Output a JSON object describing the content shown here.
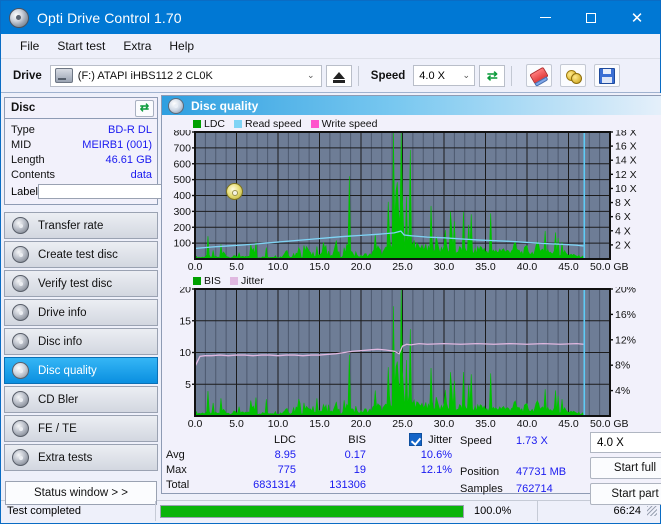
{
  "window": {
    "title": "Opti Drive Control 1.70",
    "icon": "disc-icon",
    "minimize": "–",
    "maximize": "□",
    "close": "✕"
  },
  "menu": {
    "items": [
      "File",
      "Start test",
      "Extra",
      "Help"
    ]
  },
  "toolbar": {
    "drive_label": "Drive",
    "drive_value": "(F:)  ATAPI iHBS112  2 CL0K",
    "eject_title": "Eject",
    "speed_label": "Speed",
    "speed_value": "4.0 X",
    "icons": [
      "refresh-icon",
      "erase-icon",
      "burn-icon",
      "save-icon"
    ]
  },
  "sidebar": {
    "disc": {
      "title": "Disc",
      "refresh_icon": "refresh-icon",
      "rows": [
        {
          "key": "Type",
          "value": "BD-R DL"
        },
        {
          "key": "MID",
          "value": "MEIRB1 (001)"
        },
        {
          "key": "Length",
          "value": "46.61 GB"
        },
        {
          "key": "Contents",
          "value": "data"
        }
      ],
      "label_key": "Label",
      "label_value": "",
      "label_placeholder": ""
    },
    "nav": [
      {
        "label": "Transfer rate",
        "active": false
      },
      {
        "label": "Create test disc",
        "active": false
      },
      {
        "label": "Verify test disc",
        "active": false
      },
      {
        "label": "Drive info",
        "active": false
      },
      {
        "label": "Disc info",
        "active": false
      },
      {
        "label": "Disc quality",
        "active": true
      },
      {
        "label": "CD Bler",
        "active": false
      },
      {
        "label": "FE / TE",
        "active": false
      },
      {
        "label": "Extra tests",
        "active": false
      }
    ],
    "status_window_button": "Status window > >"
  },
  "panel": {
    "title": "Disc quality",
    "icon": "disc-quality-icon"
  },
  "stats": {
    "headers": [
      "",
      "LDC",
      "BIS",
      "Jitter"
    ],
    "jitter_checked": true,
    "rows": [
      {
        "label": "Avg",
        "ldc": "8.95",
        "bis": "0.17",
        "jitter": "10.6%"
      },
      {
        "label": "Max",
        "ldc": "775",
        "bis": "19",
        "jitter": "12.1%"
      },
      {
        "label": "Total",
        "ldc": "6831314",
        "bis": "131306",
        "jitter": ""
      }
    ]
  },
  "readout": {
    "speed_key": "Speed",
    "speed_value": "1.73 X",
    "position_key": "Position",
    "position_value": "47731 MB",
    "samples_key": "Samples",
    "samples_value": "762714",
    "speed_select": "4.0 X",
    "start_full": "Start full",
    "start_part": "Start part"
  },
  "statusbar": {
    "message": "Test completed",
    "percent_text": "100.0%",
    "percent_value": 100,
    "elapsed": "66:24"
  },
  "colors": {
    "ldc": "#00c000",
    "bis": "#00c000",
    "read_speed": "#7fd4f5",
    "write_speed": "#ff55cc",
    "jitter": "#e0b8e0",
    "plot_bg": "#6e7d96",
    "accent": "#0078d4",
    "value_blue": "#1a1af0"
  },
  "chart_data": [
    {
      "type": "area",
      "name": "ldc-chart",
      "title": "",
      "xlabel": "GB",
      "ylabel": "LDC",
      "xlim": [
        0,
        50
      ],
      "ylim": [
        0,
        800
      ],
      "y2lim": [
        0,
        18
      ],
      "y2label": "X",
      "grid": true,
      "legend": [
        "LDC",
        "Read speed",
        "Write speed"
      ],
      "legend_position": "top-left",
      "xticks": [
        "0.0",
        "5.0",
        "10.0",
        "15.0",
        "20.0",
        "25.0",
        "30.0",
        "35.0",
        "40.0",
        "45.0",
        "50.0 GB"
      ],
      "yticks": [
        100,
        200,
        300,
        400,
        500,
        600,
        700,
        800
      ],
      "y2ticks": [
        "2 X",
        "4 X",
        "6 X",
        "8 X",
        "10 X",
        "12 X",
        "14 X",
        "16 X",
        "18 X"
      ],
      "series": [
        {
          "name": "LDC",
          "color": "#00c000",
          "kind": "area",
          "x": [
            0.0,
            0.5,
            1.0,
            1.5,
            2.0,
            2.5,
            3.0,
            3.5,
            4.0,
            4.5,
            5.0,
            5.5,
            6.0,
            6.5,
            7.0,
            7.5,
            8.0,
            8.5,
            9.0,
            9.5,
            10.0,
            10.5,
            11.0,
            11.5,
            12.0,
            12.5,
            13.0,
            13.5,
            14.0,
            14.5,
            15.0,
            15.5,
            16.0,
            16.5,
            17.0,
            17.5,
            18.0,
            18.5,
            19.0,
            19.5,
            20.0,
            20.5,
            21.0,
            21.5,
            22.0,
            22.5,
            23.0,
            23.5,
            24.0,
            24.3,
            24.6,
            24.9,
            25.2,
            25.5,
            25.8,
            26.1,
            26.5,
            27.0,
            27.5,
            28.0,
            28.5,
            29.0,
            29.5,
            30.0,
            30.5,
            31.0,
            31.5,
            32.0,
            32.5,
            33.0,
            33.5,
            34.0,
            34.5,
            35.0,
            35.5,
            36.0,
            36.5,
            37.0,
            37.5,
            38.0,
            38.5,
            39.0,
            39.5,
            40.0,
            40.5,
            41.0,
            41.5,
            42.0,
            42.5,
            43.0,
            43.5,
            44.0,
            44.5,
            45.0,
            45.5,
            46.0,
            46.5,
            46.8
          ],
          "y": [
            30,
            22,
            25,
            60,
            20,
            28,
            22,
            95,
            25,
            30,
            40,
            22,
            30,
            25,
            120,
            28,
            22,
            30,
            26,
            40,
            30,
            28,
            140,
            30,
            26,
            32,
            30,
            200,
            36,
            30,
            42,
            250,
            40,
            36,
            190,
            45,
            40,
            230,
            48,
            44,
            38,
            60,
            50,
            90,
            150,
            70,
            120,
            260,
            430,
            790,
            620,
            760,
            300,
            200,
            420,
            180,
            240,
            120,
            200,
            110,
            160,
            240,
            130,
            180,
            100,
            150,
            90,
            140,
            110,
            160,
            90,
            120,
            170,
            100,
            130,
            90,
            110,
            150,
            95,
            120,
            180,
            100,
            90,
            140,
            80,
            110,
            230,
            90,
            130,
            75,
            100,
            60,
            90,
            70,
            50,
            40,
            35,
            30
          ]
        },
        {
          "name": "Read speed",
          "color": "#7fd4f5",
          "kind": "line",
          "axis": "y2",
          "x": [
            0,
            2,
            4,
            6,
            8,
            10,
            12,
            14,
            16,
            18,
            20,
            22,
            24,
            24.8,
            25.2,
            26,
            28,
            30,
            32,
            34,
            36,
            38,
            40,
            42,
            44,
            46,
            46.8
          ],
          "y": [
            1.5,
            1.7,
            1.85,
            2.0,
            2.2,
            2.4,
            2.6,
            2.8,
            3.0,
            3.2,
            3.35,
            3.5,
            3.7,
            3.95,
            3.4,
            3.3,
            3.1,
            3.0,
            2.85,
            2.7,
            2.6,
            2.5,
            2.35,
            2.2,
            2.1,
            1.95,
            1.85
          ]
        },
        {
          "name": "Write speed",
          "color": "#ff55cc",
          "kind": "line",
          "axis": "y2",
          "x": [],
          "y": []
        }
      ],
      "cursor_x": 46.9
    },
    {
      "type": "area",
      "name": "bis-jitter-chart",
      "title": "",
      "xlabel": "GB",
      "ylabel": "BIS",
      "xlim": [
        0,
        50
      ],
      "ylim": [
        0,
        20
      ],
      "y2lim": [
        0,
        20
      ],
      "y2label": "%",
      "grid": true,
      "legend": [
        "BIS",
        "Jitter"
      ],
      "legend_position": "top-left",
      "xticks": [
        "0.0",
        "5.0",
        "10.0",
        "15.0",
        "20.0",
        "25.0",
        "30.0",
        "35.0",
        "40.0",
        "45.0",
        "50.0 GB"
      ],
      "yticks": [
        5,
        10,
        15,
        20
      ],
      "y2ticks": [
        "4%",
        "8%",
        "12%",
        "16%",
        "20%"
      ],
      "series": [
        {
          "name": "BIS",
          "color": "#00c000",
          "kind": "area",
          "x": [
            0.0,
            0.5,
            1.0,
            1.5,
            2.0,
            2.5,
            3.0,
            3.5,
            4.0,
            4.5,
            5.0,
            5.5,
            6.0,
            6.5,
            7.0,
            7.5,
            8.0,
            8.5,
            9.0,
            9.5,
            10.0,
            10.5,
            11.0,
            11.5,
            12.0,
            12.5,
            13.0,
            13.5,
            14.0,
            14.5,
            15.0,
            15.5,
            16.0,
            16.5,
            17.0,
            17.5,
            18.0,
            18.5,
            19.0,
            19.5,
            20.0,
            20.5,
            21.0,
            21.5,
            22.0,
            22.5,
            23.0,
            23.5,
            24.0,
            24.3,
            24.6,
            24.9,
            25.2,
            25.5,
            25.8,
            26.1,
            26.5,
            27.0,
            27.5,
            28.0,
            28.5,
            29.0,
            29.5,
            30.0,
            30.5,
            31.0,
            31.5,
            32.0,
            32.5,
            33.0,
            33.5,
            34.0,
            34.5,
            35.0,
            35.5,
            36.0,
            36.5,
            37.0,
            37.5,
            38.0,
            38.5,
            39.0,
            39.5,
            40.0,
            40.5,
            41.0,
            41.5,
            42.0,
            42.5,
            43.0,
            43.5,
            44.0,
            44.5,
            45.0,
            45.5,
            46.0,
            46.5,
            46.8
          ],
          "y": [
            1.2,
            0.9,
            1.0,
            1.6,
            0.8,
            1.0,
            0.9,
            2.2,
            1.0,
            1.1,
            1.4,
            0.9,
            1.1,
            1.0,
            2.8,
            1.0,
            0.9,
            1.1,
            1.0,
            1.3,
            1.1,
            1.0,
            3.0,
            1.1,
            1.0,
            1.2,
            1.1,
            3.8,
            1.3,
            1.1,
            1.4,
            4.3,
            1.4,
            1.3,
            3.6,
            1.5,
            1.4,
            4.1,
            1.6,
            1.5,
            1.3,
            2.0,
            1.7,
            2.6,
            3.5,
            2.2,
            3.0,
            5.2,
            8.5,
            14.0,
            11.0,
            13.5,
            6.5,
            4.5,
            8.0,
            4.0,
            5.0,
            3.0,
            4.4,
            2.6,
            3.6,
            5.0,
            3.0,
            4.0,
            2.4,
            3.4,
            2.2,
            3.2,
            2.6,
            3.6,
            2.2,
            2.8,
            3.8,
            2.4,
            3.0,
            2.2,
            2.6,
            3.4,
            2.3,
            2.8,
            4.0,
            2.4,
            2.2,
            3.2,
            2.0,
            2.6,
            5.0,
            2.2,
            3.0,
            1.8,
            2.4,
            1.5,
            2.2,
            1.7,
            1.3,
            1.0,
            0.9,
            0.8
          ]
        },
        {
          "name": "Jitter",
          "color": "#e0b8e0",
          "kind": "line",
          "axis": "y2",
          "x": [
            0,
            0.6,
            1.2,
            2,
            3,
            4,
            5,
            6,
            7,
            8,
            9,
            10,
            11,
            12,
            13,
            14,
            15,
            16,
            17,
            18,
            19,
            20,
            21,
            22,
            23,
            24,
            24.6,
            25,
            25.5,
            26,
            27,
            28,
            30,
            32,
            34,
            36,
            38,
            40,
            42,
            44,
            46,
            46.8
          ],
          "y": [
            7.8,
            9.4,
            9.5,
            9.5,
            9.6,
            9.5,
            9.6,
            9.6,
            9.5,
            9.6,
            9.6,
            9.5,
            9.6,
            9.6,
            9.5,
            9.6,
            9.6,
            9.7,
            9.8,
            10.0,
            10.2,
            10.3,
            10.4,
            10.5,
            10.4,
            10.2,
            9.8,
            11.0,
            11.3,
            11.2,
            11.4,
            11.3,
            11.4,
            11.3,
            11.4,
            11.3,
            11.4,
            11.3,
            11.4,
            11.3,
            11.4,
            11.3
          ]
        }
      ],
      "cursor_x": 46.9
    }
  ]
}
